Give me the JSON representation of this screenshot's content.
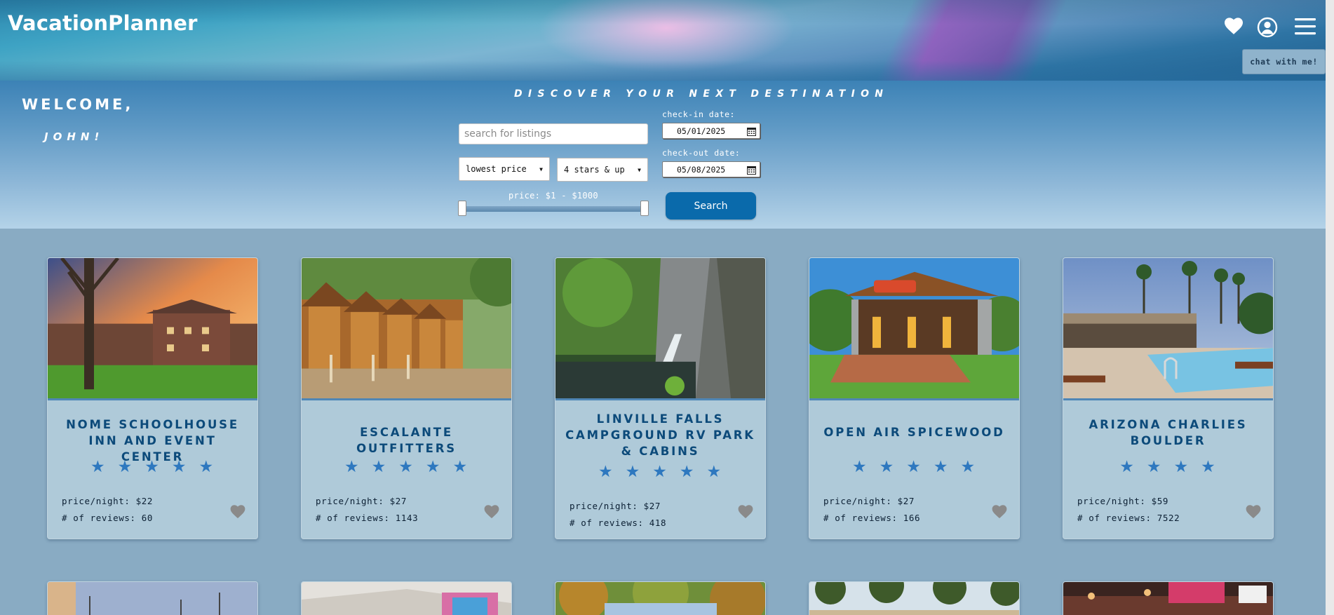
{
  "app": {
    "brand": "VacationPlanner"
  },
  "header": {
    "chat_label": "chat with me!",
    "icons": [
      "heart-icon",
      "user-icon",
      "menu-icon"
    ]
  },
  "welcome": {
    "greeting": "WELCOME,",
    "name": "JOHN!"
  },
  "search": {
    "tagline": "DISCOVER YOUR NEXT DESTINATION",
    "placeholder": "search for listings",
    "sort_selected": "lowest price",
    "rating_selected": "4 stars & up",
    "price_label": "price: $1 - $1000",
    "price_min": 1,
    "price_max": 1000,
    "checkin_label": "check-in date:",
    "checkin_value": "05/01/2025",
    "checkout_label": "check-out date:",
    "checkout_value": "05/08/2025",
    "button_label": "Search"
  },
  "colors": {
    "accent": "#0a6aab",
    "card_title": "#0c4a7a",
    "star": "#2e78bf",
    "card_bg": "#afcad9",
    "fav_heart": "#8a8a8a"
  },
  "listings": [
    {
      "title": "NOME SCHOOLHOUSE INN AND EVENT CENTER",
      "stars": 5,
      "price": "price/night: $22",
      "reviews": "# of reviews: 60"
    },
    {
      "title": "ESCALANTE OUTFITTERS",
      "stars": 5,
      "price": "price/night: $27",
      "reviews": "# of reviews: 1143"
    },
    {
      "title": "LINVILLE FALLS CAMPGROUND RV PARK & CABINS",
      "stars": 5,
      "price": "price/night: $27",
      "reviews": "# of reviews: 418"
    },
    {
      "title": "OPEN AIR SPICEWOOD",
      "stars": 5,
      "price": "price/night: $27",
      "reviews": "# of reviews: 166"
    },
    {
      "title": "ARIZONA CHARLIES BOULDER",
      "stars": 4,
      "price": "price/night: $59",
      "reviews": "# of reviews: 7522"
    }
  ]
}
